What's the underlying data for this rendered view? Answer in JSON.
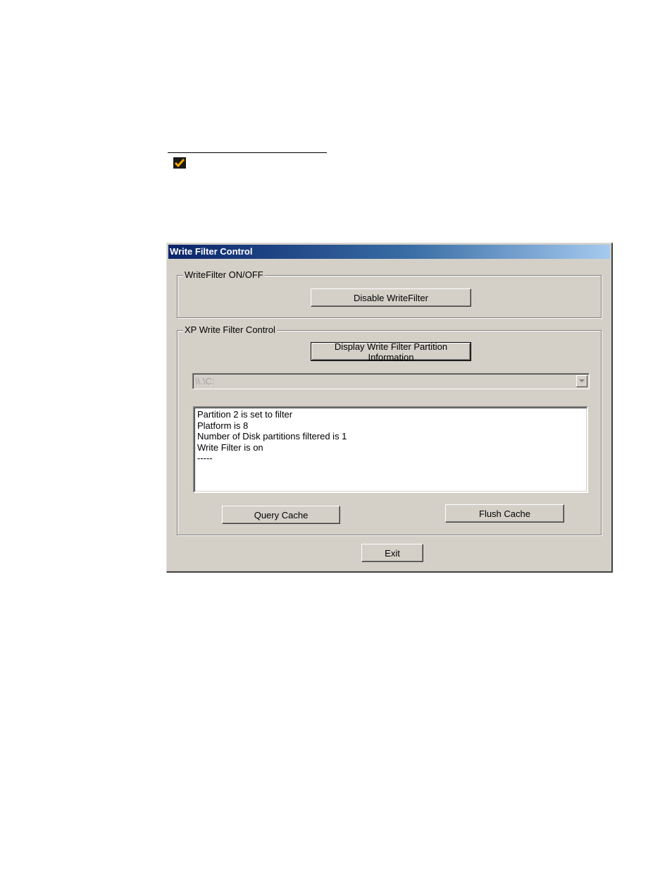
{
  "window": {
    "title": "Write Filter Control"
  },
  "writefilter_group": {
    "legend": "WriteFilter ON/OFF",
    "disable_button": "Disable WriteFilter"
  },
  "xp_group": {
    "legend": "XP Write Filter Control",
    "display_button": "Display Write Filter Partition Information",
    "drive_select": "\\\\.\\C:",
    "output_lines": [
      "Partition 2 is set to filter",
      "Platform is 8",
      "Number of Disk partitions filtered is 1",
      "Write Filter is on",
      "-----"
    ],
    "query_cache_button": "Query Cache",
    "flush_cache_button": "Flush Cache"
  },
  "exit_button": "Exit",
  "colors": {
    "titlebar_start": "#0a246a",
    "titlebar_end": "#a6caf0",
    "face": "#d4d0c8",
    "check_icon": "#f5a800"
  },
  "icons": {
    "note_marker": "check-icon",
    "combo_arrow": "chevron-down-icon"
  }
}
